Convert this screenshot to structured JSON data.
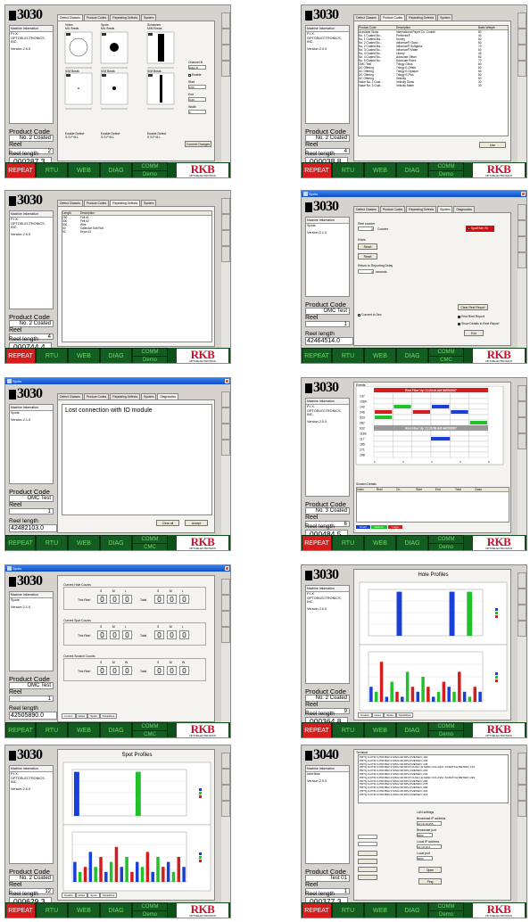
{
  "common": {
    "logo": "3030",
    "logo_s10": "3040",
    "machine_info_header": "Machine Information",
    "buttons": {
      "repeat": "REPEAT",
      "rtu": "RTU",
      "web": "WEB",
      "diag": "DIAG",
      "comm": "COMM",
      "demo": "Demo",
      "cmc": "CMC"
    },
    "rkb": "RKB",
    "rkb_sub": "OPTOELECTRONICS",
    "product_code_label": "Product Code",
    "reel_label": "Reel",
    "reel_length_label": "Reel length"
  },
  "screens": [
    {
      "tabs": [
        "Defect Classes",
        "Product Codes",
        "Repeating Defects",
        "System"
      ],
      "info": [
        "P.I.X.",
        "OPTOELECTRONICS,",
        "INC.",
        "Version 2.0.0"
      ],
      "product": "No. 2 Coated",
      "reel": "2",
      "length": "000287.3",
      "defect_cols": [
        "Holes",
        "Spots",
        "Scratches"
      ],
      "defect_sub": [
        "M/L Break",
        "M/L Break",
        "M/M Break"
      ],
      "defect_sub2": [
        "S/M Break",
        "S/M Break",
        "S/M Break"
      ],
      "enable_label": "Enable Defect",
      "enable_opts": "S  S  P  M  L",
      "channel_label": "Channel B",
      "enable_cb": "Enable",
      "start_label": "Start",
      "end_label": "End",
      "width_label": "Width",
      "commit": "Commit Changes",
      "channel_value": "Edge D",
      "start_value": "0.00",
      "end_value": "0.00",
      "width_value": "0"
    },
    {
      "tabs": [
        "Defect Classes",
        "Product Codes",
        "Repeating Defects",
        "System"
      ],
      "info": [
        "P.I.X.",
        "OPTOELECTRONICS,",
        "INC.",
        "Version 2.0.0"
      ],
      "product": "No. 2 Coated",
      "reel": "4",
      "length": "000038.8",
      "cols": [
        "Product Code",
        "Description",
        "Basis Weight"
      ],
      "rows": [
        [
          "Accolade Gloss",
          "International Paper Co. Corinth",
          "80"
        ],
        [
          "No. 1 Coated Bo...",
          "Preferred®",
          "40"
        ],
        [
          "No. 1 Coated Ma...",
          "Survey",
          "50"
        ],
        [
          "No. 2 Coated Bo...",
          "Influence® Gloss",
          "60"
        ],
        [
          "No. 2 Coated Ma...",
          "Influence® Softgloss",
          "70"
        ],
        [
          "No. 3 Coated Bo...",
          "Influence® Matte",
          "60"
        ],
        [
          "No. 4 Coated Bo...",
          "Liberty",
          "45"
        ],
        [
          "No. 4 Coated Bo...",
          "Advocate Offset",
          "60"
        ],
        [
          "No. 5 Coated Bo...",
          "Advocate Rotex",
          "70"
        ],
        [
          "OMC Test",
          "Trilogy Gloss",
          "80"
        ],
        [
          "UC Offering",
          "Trilogy E-Offset",
          "60"
        ],
        [
          "UC Offering",
          "Trilogy E-Opaque",
          "60"
        ],
        [
          "UC Offering",
          "Trilogy E-Plus",
          "50"
        ],
        [
          "UC Offering",
          "Velocity",
          "60"
        ],
        [
          "Value No. 3 Coat...",
          "Velocity Gloss",
          "30"
        ],
        [
          "Value No. 3 Coat...",
          "Velocity Matte",
          "30"
        ]
      ],
      "use": "Use"
    },
    {
      "tabs": [
        "Defect Classes",
        "Product Codes",
        "Repeating Defects",
        "System"
      ],
      "info": [
        "P.I.X.",
        "OPTOELECTRONICS,",
        "INC.",
        "Version 2.0.0"
      ],
      "product": "No. 2 Coated",
      "reel": "4",
      "length": "000744.4",
      "cols": [
        "Length",
        "Description"
      ],
      "rows": [
        [
          "250",
          "Felt #1"
        ],
        [
          "300",
          "Felt #2"
        ],
        [
          "300",
          "Wire"
        ],
        [
          "40",
          "Calendar Soft Roll"
        ],
        [
          "90",
          "Dryer #1"
        ]
      ]
    },
    {
      "title": "Spots",
      "tabs": [
        "Defect Classes",
        "Product Codes",
        "Repeating Defects",
        "System",
        "Diagnostics"
      ],
      "info": [
        "Spots",
        "Version 2.1.0"
      ],
      "product": "OMC Test",
      "reel": "1",
      "length": "42464514.0",
      "reel_counter": "Reel counter",
      "counter_btn": "Counter",
      "value_zero": "0",
      "status": "Spot/Hole Hit",
      "holes": "Holes",
      "reset_btn": "Reset",
      "reset2": "Reset",
      "return_delay": "Return to Reporting Delay",
      "seconds": "seconds",
      "convert_btn": "Convert to Dev",
      "clear_reel": "Clear Reel Report",
      "print_reel": "Print Reel Report",
      "show_details": "Show Details in Reel Report",
      "exit": "Exit"
    },
    {
      "title": "Spots",
      "tabs": [
        "Defect Classes",
        "Product Codes",
        "Repeating Defects",
        "System",
        "Diagnostics"
      ],
      "info": [
        "Spots",
        "Version 2.1.0"
      ],
      "product": "OMC Test",
      "reel": "1",
      "length": "42482103.0",
      "message": "Lost connection with IO module",
      "clear_all": "Clear all",
      "accept": "Accept"
    },
    {
      "info": [
        "P.I.X.",
        "OPTOELECTRONICS,",
        "INC.",
        "Version 2.0.0"
      ],
      "product": "No. 3 Coated",
      "reel": "6",
      "length": "000484.5",
      "events_label": "Events",
      "banner1": "Reel Fiber Up: 11:24:41 AM 04/05/2007",
      "banner2": "Reel Fiber Up: 11:29:56 AM 04/05/2007",
      "ev_rows": [
        "137",
        "1080",
        "142",
        "246",
        "523",
        "287",
        "632",
        "1189",
        "117",
        "185",
        "271",
        "298"
      ],
      "scale": [
        "1",
        "2",
        "3",
        "4",
        "5"
      ],
      "scratch_label": "Scratch Details",
      "scratch_cols": [
        "Index",
        "Reel",
        "Ch.",
        "Start",
        "End",
        "Total",
        "Class"
      ],
      "legend": [
        "Small",
        "Medium",
        "Large"
      ]
    },
    {
      "title": "Spots",
      "info": [
        "Spots",
        "Version 2.1.0"
      ],
      "product": "OMC Test",
      "reel": "1",
      "length": "42505890.0",
      "groups": [
        "Current Hole Counts",
        "Current Spot Counts",
        "Current Scratch Counts"
      ],
      "this_reel": "This Reel",
      "total": "Total",
      "sml": [
        "S",
        "M",
        "L"
      ],
      "smw": [
        "S",
        "M",
        "W"
      ],
      "zero": "0",
      "bottom_tabs": [
        "Counts",
        "Holes",
        "Spots",
        "Scratches"
      ]
    },
    {
      "info": [
        "P.I.X.",
        "OPTOELECTRONICS,",
        "INC.",
        "Version 2.0.0"
      ],
      "product": "No. 2 Coated",
      "reel": "9",
      "length": "000364.8",
      "chart_title": "Hole Profiles",
      "sub1": "Holes / Reel",
      "sub2": "Holes / Product",
      "bottom_tabs": [
        "Counts",
        "Holes",
        "Spots",
        "Scratches"
      ],
      "legend": [
        "S",
        "M",
        "L"
      ]
    },
    {
      "info": [
        "P.I.X.",
        "OPTOELECTRONICS,",
        "INC.",
        "Version 2.0.0"
      ],
      "product": "No. 2 Coated",
      "reel": "12",
      "length": "000629.3",
      "chart_title": "Spot Profiles",
      "sub1": "Spots / Reel",
      "sub2": "Spots / Product",
      "bottom_tabs": [
        "Counts",
        "Holes",
        "Spots",
        "Scratches"
      ],
      "legend": [
        "S",
        "M",
        "L"
      ]
    },
    {
      "info": [
        "Interface",
        "Version 2.0.0"
      ],
      "product": "Test 01",
      "reel": "1",
      "length": "000377.3",
      "terminal_label": "Terminal",
      "terminal_lines": [
        "PRTQ,ILOTD=1;PROBH=1;MSG=4#;RPL3;METER=,100",
        "PRTQ,ILOTD=1;PROBH=1;MSG=4#;RPL3;METER=,205",
        "PRTQ,ILOTD=1;PROBH=1;MSG=4#;RPL3;METER=,135",
        "PRTQ,ILOTD=1;PROBH=1;MSG=4#;DFCT;CHNL=;E:SIZE=;CCLASS=;SCRATCH;METER=,176",
        "PRTQ,ILOTD=1;PROBH=1;MSG=4#;RPL3;METER=,209",
        "PRTQ,ILOTD=1;PROBH=1;MSG=4#;RPL3;METER=,224",
        "PRTQ,ILOTD=1;PROBH=1;MSG=4#;DFCT;CHNL=;E:SIZE=;CCLASS=;SCRATCH;METER=,239",
        "PRTQ,ILOTD=1;PROBH=1;MSG=4#;RPL3;METER=,263",
        "PRTQ,ILOTD=1;PROBH=1;MSG=4#;RPL3;METER=,278",
        "PRTQ,ILOTD=1;PROBH=1;MSG=4#;RPL3;METER=,289",
        "PRTQ,ILOTD=1;PROBH=1;MSG=4#;RPL3;METER=,301",
        "PRTQ,ILOTD=1;PROBH=1;MSG=4#;RPL3;METER=,313"
      ],
      "lan_label": "LAN settings",
      "bip_label": "Broadcast IP address",
      "bip": "10.10.10.255",
      "bport_label": "Broadcast port",
      "bport": "5002",
      "lip_label": "Local IP address",
      "lip": "10.10.10.2",
      "lport_label": "Local port",
      "lport": "5000",
      "open": "Open",
      "ping": "Ping"
    }
  ]
}
